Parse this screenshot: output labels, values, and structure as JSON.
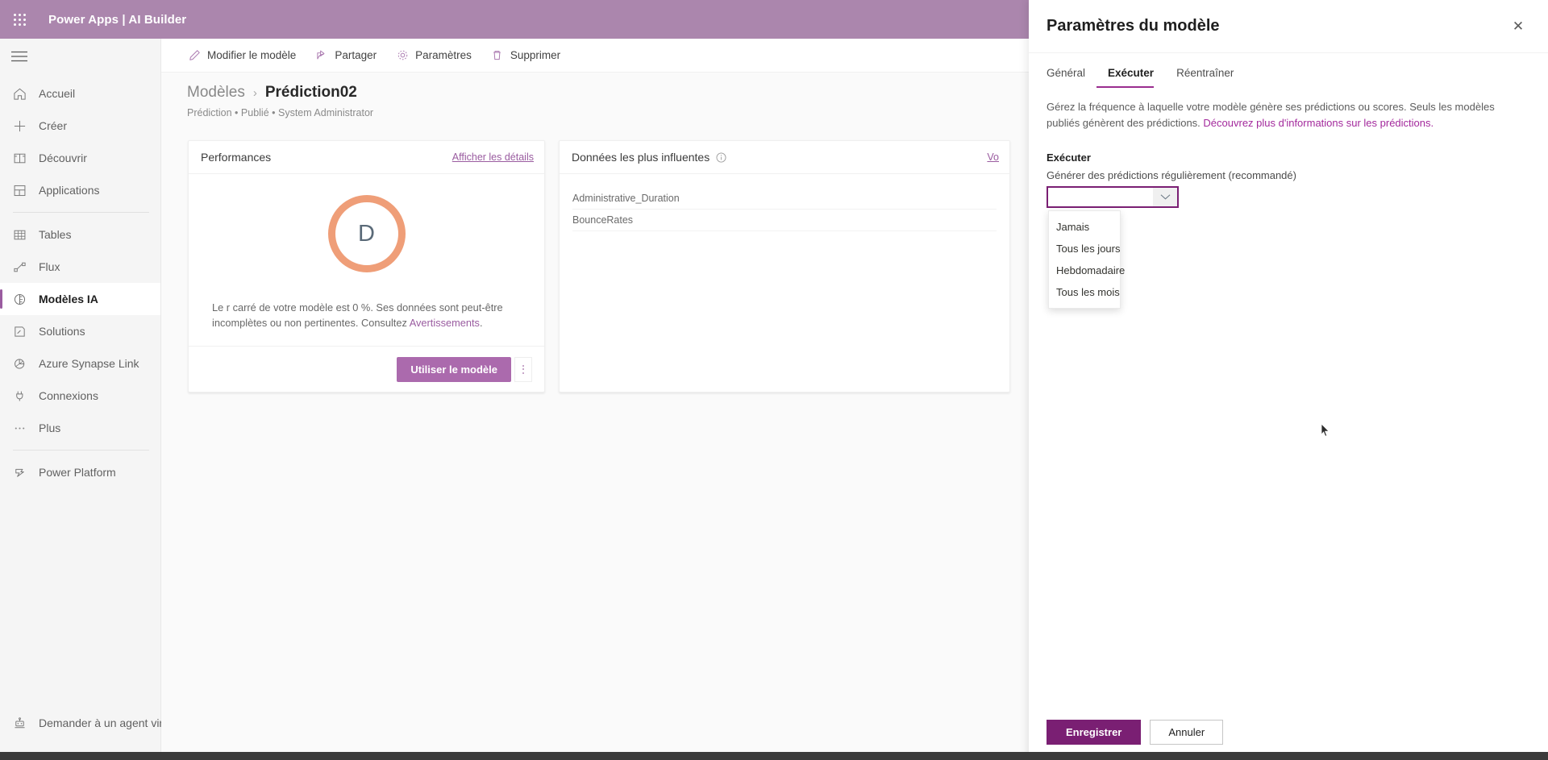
{
  "suite": {
    "waffle_label": "app-launcher",
    "title": "Power Apps  |  AI Builder",
    "brand_color": "#ab86ad"
  },
  "leftnav": {
    "menu_label": "Menu",
    "items": [
      {
        "label": "Accueil",
        "icon": "home-icon",
        "selected": false
      },
      {
        "label": "Créer",
        "icon": "plus-icon",
        "selected": false
      },
      {
        "label": "Découvrir",
        "icon": "book-icon",
        "selected": false
      },
      {
        "label": "Applications",
        "icon": "apps-grid-icon",
        "selected": false
      },
      {
        "label": "Tables",
        "icon": "table-icon",
        "selected": false
      },
      {
        "label": "Flux",
        "icon": "flow-icon",
        "selected": false
      },
      {
        "label": "Modèles IA",
        "icon": "ai-brain-icon",
        "selected": true
      },
      {
        "label": "Solutions",
        "icon": "solutions-icon",
        "selected": false
      },
      {
        "label": "Azure Synapse Link",
        "icon": "synapse-icon",
        "selected": false
      },
      {
        "label": "Connexions",
        "icon": "plug-icon",
        "selected": false
      },
      {
        "label": "Plus",
        "icon": "ellipsis-icon",
        "selected": false
      },
      {
        "label": "Power Platform",
        "icon": "power-platform-icon",
        "selected": false
      }
    ],
    "bottom_item": {
      "label": "Demander à un agent virt",
      "icon": "robot-icon"
    }
  },
  "commandbar": {
    "items": [
      {
        "label": "Modifier le modèle",
        "icon": "pencil-icon"
      },
      {
        "label": "Partager",
        "icon": "share-icon"
      },
      {
        "label": "Paramètres",
        "icon": "gear-icon"
      },
      {
        "label": "Supprimer",
        "icon": "trash-icon"
      }
    ]
  },
  "page": {
    "breadcrumb_parent": "Modèles",
    "breadcrumb_sep": "›",
    "breadcrumb_current": "Prédiction02",
    "subtitle": "Prédiction • Publié • System Administrator"
  },
  "cards": {
    "performance": {
      "title": "Performances",
      "details_link": "Afficher les détails",
      "grade": "D",
      "grade_color": "#ef9e78",
      "description_before": "Le r carré de votre modèle est 0 %. Ses données sont peut-être incomplètes ou non pertinentes. Consultez ",
      "description_link": "Avertissements",
      "description_after": ".",
      "primary_button": "Utiliser le modèle",
      "kebab_label": "more-options"
    },
    "influential": {
      "title": "Données les plus influentes",
      "info_icon": "info-icon",
      "view_link": "Vo",
      "rows": [
        "Administrative_Duration",
        "BounceRates"
      ]
    }
  },
  "panel": {
    "title": "Paramètres du modèle",
    "close_label": "✕",
    "tabs": [
      {
        "label": "Général",
        "active": false
      },
      {
        "label": "Exécuter",
        "active": true
      },
      {
        "label": "Réentraîner",
        "active": false
      }
    ],
    "description_before": "Gérez la fréquence à laquelle votre modèle génère ses prédictions ou scores. Seuls les modèles publiés génèrent des prédictions. ",
    "description_link": "Découvrez plus d'informations sur les prédictions.",
    "section_label": "Exécuter",
    "field_label": "Générer des prédictions régulièrement (recommandé)",
    "dropdown": {
      "value": "",
      "placeholder": "",
      "caret_icon": "chevron-down-icon",
      "open": true,
      "options": [
        "Jamais",
        "Tous les jours",
        "Hebdomadaire",
        "Tous les mois"
      ]
    },
    "save_button": "Enregistrer",
    "cancel_button": "Annuler",
    "accent_color": "#7a1f73"
  }
}
